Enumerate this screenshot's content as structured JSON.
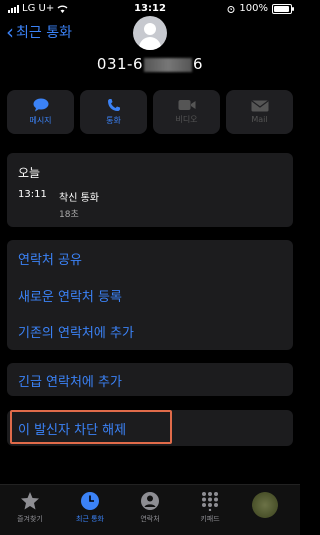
{
  "status": {
    "carrier": "LG U+",
    "time": "13:12",
    "battery": "100%"
  },
  "nav": {
    "back_label": "최근 통화"
  },
  "contact": {
    "number_prefix": "031-6",
    "number_suffix": "6"
  },
  "actions": [
    {
      "label": "메시지",
      "icon": "message-icon",
      "enabled": true
    },
    {
      "label": "통화",
      "icon": "phone-icon",
      "enabled": true
    },
    {
      "label": "비디오",
      "icon": "video-icon",
      "enabled": false
    },
    {
      "label": "Mail",
      "icon": "mail-icon",
      "enabled": false
    }
  ],
  "recent": {
    "day": "오늘",
    "time": "13:11",
    "type": "착신 통화",
    "duration": "18초"
  },
  "options": {
    "share": "연락처 공유",
    "new_contact": "새로운 연락처 등록",
    "add_existing": "기존의 연락처에 추가",
    "emergency": "긴급 연락처에 추가",
    "unblock": "이 발신자 차단 해제"
  },
  "tabs": [
    {
      "label": "즐겨찾기",
      "icon": "star-icon",
      "active": false
    },
    {
      "label": "최근 통화",
      "icon": "clock-icon",
      "active": true
    },
    {
      "label": "연락처",
      "icon": "person-icon",
      "active": false
    },
    {
      "label": "키패드",
      "icon": "keypad-icon",
      "active": false
    }
  ],
  "colors": {
    "accent": "#3b82f6",
    "highlight": "#e06b4a",
    "card": "#1c1c1e"
  }
}
